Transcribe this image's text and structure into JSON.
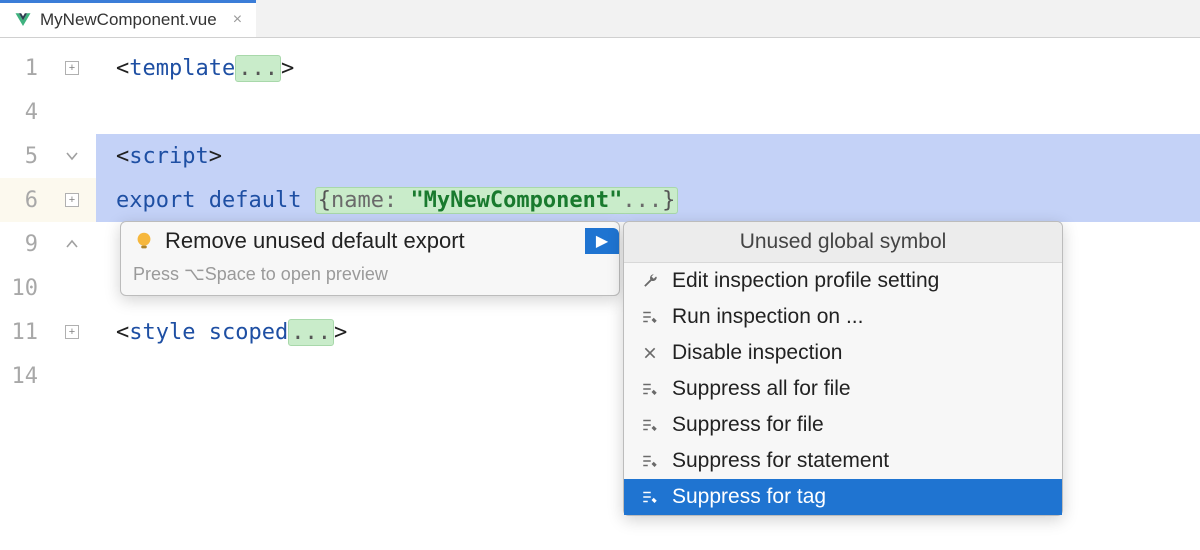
{
  "tab": {
    "filename": "MyNewComponent.vue",
    "close_glyph": "×"
  },
  "lines": {
    "l1": {
      "num": "1"
    },
    "l4": {
      "num": "4"
    },
    "l5": {
      "num": "5"
    },
    "l6": {
      "num": "6"
    },
    "l9": {
      "num": "9"
    },
    "l10": {
      "num": "10"
    },
    "l11": {
      "num": "11"
    },
    "l14": {
      "num": "14"
    }
  },
  "code": {
    "lt": "<",
    "gt": ">",
    "template_kw": "template",
    "ellipsis": "...",
    "script_kw": "script",
    "export_kw": "export",
    "default_kw": "default",
    "obj_open": "{",
    "name_key": "name:",
    "name_val": "\"MyNewComponent\"",
    "obj_ellip": "...",
    "obj_close": "}",
    "style_kw": "style",
    "scoped_kw": "scoped"
  },
  "intention": {
    "label": "Remove unused default export",
    "hint": "Press ⌥Space to open preview",
    "expand_glyph": "▶"
  },
  "submenu": {
    "header": "Unused global symbol",
    "items": [
      {
        "icon": "wrench-icon",
        "label": "Edit inspection profile setting"
      },
      {
        "icon": "run-pencil-icon",
        "label": "Run inspection on ..."
      },
      {
        "icon": "close-icon",
        "label": "Disable inspection"
      },
      {
        "icon": "run-pencil-icon",
        "label": "Suppress all for file"
      },
      {
        "icon": "run-pencil-icon",
        "label": "Suppress for file"
      },
      {
        "icon": "run-pencil-icon",
        "label": "Suppress for statement"
      },
      {
        "icon": "run-pencil-icon",
        "label": "Suppress for tag"
      }
    ],
    "selected_index": 6
  }
}
